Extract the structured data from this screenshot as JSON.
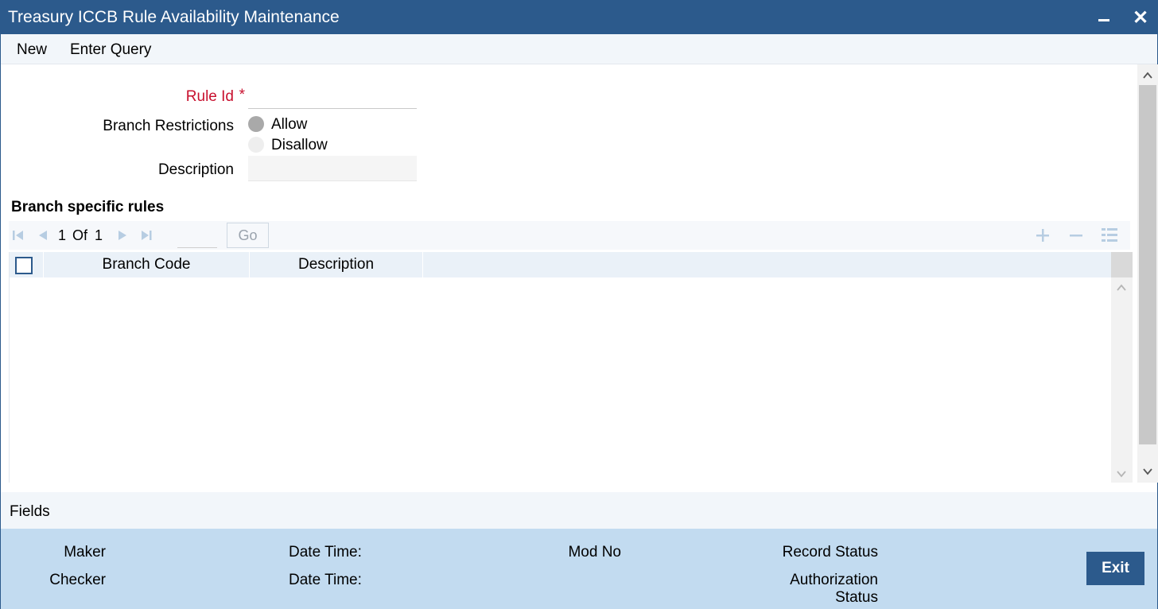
{
  "window": {
    "title": "Treasury ICCB Rule Availability Maintenance"
  },
  "menu": {
    "new_label": "New",
    "enter_query_label": "Enter Query"
  },
  "form": {
    "rule_id": {
      "label": "Rule Id",
      "required_mark": "*",
      "value": ""
    },
    "branch_restrictions": {
      "label": "Branch Restrictions",
      "options": [
        "Allow",
        "Disallow"
      ],
      "selected": "Allow"
    },
    "description": {
      "label": "Description",
      "value": ""
    }
  },
  "branch_rules": {
    "title": "Branch specific rules",
    "pagination": {
      "current": "1",
      "of_label": "Of",
      "total": "1",
      "go_label": "Go"
    },
    "columns": [
      "Branch Code",
      "Description"
    ],
    "rows": []
  },
  "fields_label": "Fields",
  "audit": {
    "maker_label": "Maker",
    "checker_label": "Checker",
    "date_time_label": "Date Time:",
    "mod_no_label": "Mod No",
    "record_status_label": "Record Status",
    "authorization_status_label": "Authorization Status"
  },
  "exit_label": "Exit",
  "colors": {
    "titlebar": "#2c5a8c",
    "required": "#c8102e",
    "footer": "#c2dbf0",
    "exit_button": "#2c5a8c"
  }
}
